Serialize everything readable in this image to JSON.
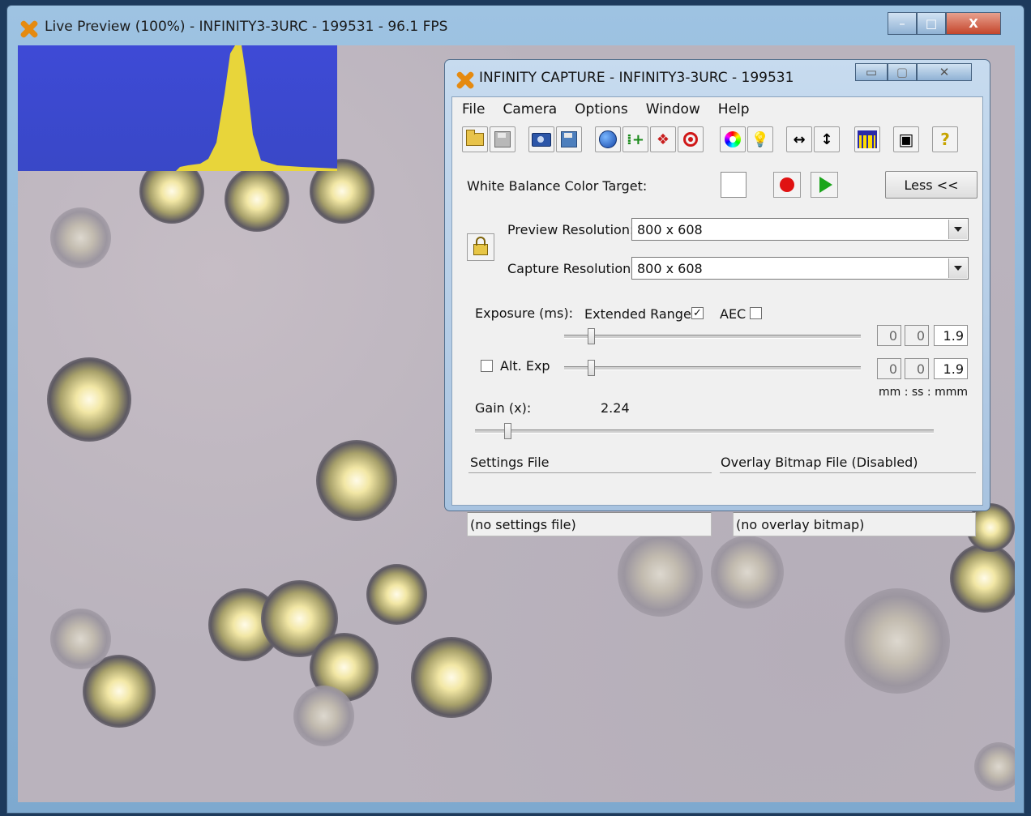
{
  "outer_window": {
    "title": "Live Preview (100%) - INFINITY3-3URC - 199531 - 96.1 FPS",
    "caption_buttons": {
      "minimize": "–",
      "maximize": "□",
      "close": "X"
    }
  },
  "capture_dialog": {
    "title": "INFINITY CAPTURE - INFINITY3-3URC - 199531",
    "caption_buttons": {
      "minimize": "▭",
      "maximize": "▢",
      "close": "✕"
    },
    "menu": [
      "File",
      "Camera",
      "Options",
      "Window",
      "Help"
    ],
    "toolbar_icons": [
      "open-folder-icon",
      "save-icon",
      "camera-snapshot-icon",
      "save-image-icon",
      "globe-icon",
      "add-crosshair-icon",
      "color-diamond-icon",
      "target-icon",
      "color-wheel-icon",
      "lightbulb-icon",
      "flip-horizontal-icon",
      "flip-vertical-icon",
      "histogram-icon",
      "video-record-icon",
      "help-icon"
    ],
    "white_balance": {
      "label": "White Balance Color Target:",
      "swatch_color": "#ffffff"
    },
    "less_button": "Less <<",
    "preview_resolution": {
      "label": "Preview Resolution:",
      "value": "800 x 608"
    },
    "capture_resolution": {
      "label": "Capture Resolution:",
      "value": "800 x 608"
    },
    "exposure": {
      "label": "Exposure (ms):",
      "extended_range_label": "Extended Range",
      "extended_range_checked": true,
      "aec_label": "AEC",
      "aec_checked": false,
      "mm": "0",
      "ss": "0",
      "mmm": "1.9",
      "slider_fraction": 0.09
    },
    "alt_exposure": {
      "label": "Alt. Exp",
      "checked": false,
      "mm": "0",
      "ss": "0",
      "mmm": "1.9",
      "slider_fraction": 0.09
    },
    "time_units": "mm : ss  : mmm",
    "gain": {
      "label": "Gain (x):",
      "value": "2.24",
      "slider_fraction": 0.07
    },
    "settings_file": {
      "label": "Settings File",
      "value": "(no settings file)"
    },
    "overlay_file": {
      "label": "Overlay Bitmap File (Disabled)",
      "value": "(no overlay bitmap)"
    }
  },
  "colors": {
    "accent_title": "#9ec3e2",
    "histogram_bg": "#3948c7",
    "histogram_fill": "#e8d53a"
  }
}
